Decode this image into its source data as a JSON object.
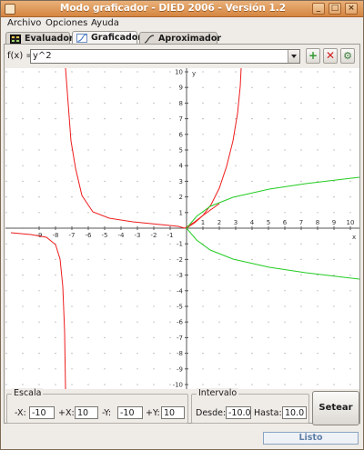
{
  "window": {
    "title": "Modo graficador - DIED 2006 - Versión 1.2",
    "min": "_",
    "max": "□",
    "close": "×"
  },
  "menu": [
    {
      "label": "Archivo"
    },
    {
      "label": "Opciones"
    },
    {
      "label": "Ayuda"
    }
  ],
  "tabs": [
    {
      "label": "Evaluador"
    },
    {
      "label": "Graficador"
    },
    {
      "label": "Aproximador"
    }
  ],
  "function": {
    "label": "f(x) =",
    "value": "y^2"
  },
  "toolbar": {
    "add": "+",
    "remove": "✕",
    "config": "⚙"
  },
  "graph": {
    "axis_x_label": "x",
    "axis_y_label": "y",
    "x_ticks": [
      -9,
      -8,
      -7,
      -6,
      -5,
      -4,
      -3,
      -2,
      -1,
      1,
      2,
      3,
      4,
      5,
      6,
      7,
      8,
      9,
      10
    ],
    "y_ticks": [
      10,
      9,
      8,
      7,
      6,
      5,
      4,
      3,
      2,
      1,
      -1,
      -2,
      -3,
      -4,
      -5,
      -6,
      -7,
      -8,
      -9,
      -10
    ],
    "curve_colors": {
      "red": "#ee1c1c",
      "green": "#22cc22"
    }
  },
  "escala": {
    "title": "Escala",
    "fields": [
      {
        "label": "-X:",
        "value": "-10"
      },
      {
        "label": "+X:",
        "value": "10"
      },
      {
        "label": "-Y:",
        "value": "-10"
      },
      {
        "label": "+Y:",
        "value": "10"
      }
    ]
  },
  "intervalo": {
    "title": "Intervalo",
    "desde_label": "Desde:",
    "desde_value": "-10.0",
    "hasta_label": "Hasta:",
    "hasta_value": "10.0"
  },
  "setear_label": "Setear",
  "status": "Listo"
}
